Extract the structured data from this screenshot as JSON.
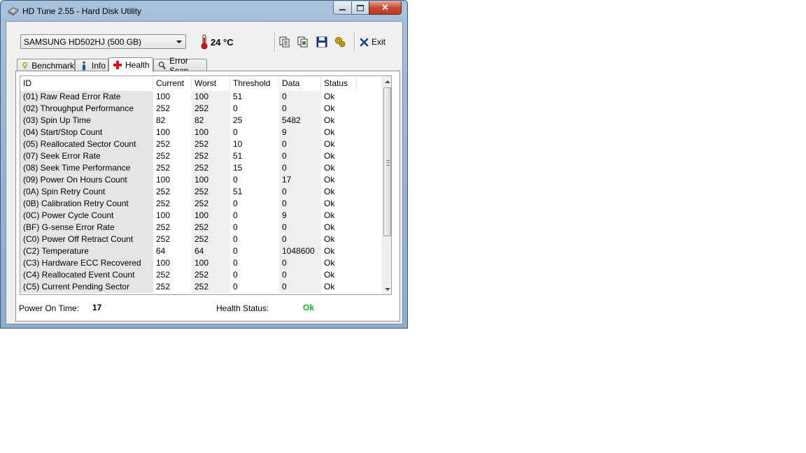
{
  "window": {
    "title": "HD Tune 2.55 - Hard Disk Utility",
    "close_symbol": "✕"
  },
  "toolbar": {
    "drive": "SAMSUNG HD502HJ (500 GB)",
    "temperature": "24 °C",
    "exit_label": "Exit",
    "icons": [
      "copy-info-icon",
      "copy-screenshot-icon",
      "save-icon",
      "options-icon",
      "exit-icon"
    ]
  },
  "tabs": [
    {
      "label": "Benchmark",
      "icon": "benchmark-icon",
      "active": false
    },
    {
      "label": "Info",
      "icon": "info-icon",
      "active": false
    },
    {
      "label": "Health",
      "icon": "health-icon",
      "active": true
    },
    {
      "label": "Error Scan",
      "icon": "error-scan-icon",
      "active": false
    }
  ],
  "health_table": {
    "columns": [
      "ID",
      "Current",
      "Worst",
      "Threshold",
      "Data",
      "Status"
    ],
    "rows": [
      [
        "(01) Raw Read Error Rate",
        "100",
        "100",
        "51",
        "0",
        "Ok"
      ],
      [
        "(02) Throughput Performance",
        "252",
        "252",
        "0",
        "0",
        "Ok"
      ],
      [
        "(03) Spin Up Time",
        "82",
        "82",
        "25",
        "5482",
        "Ok"
      ],
      [
        "(04) Start/Stop Count",
        "100",
        "100",
        "0",
        "9",
        "Ok"
      ],
      [
        "(05) Reallocated Sector Count",
        "252",
        "252",
        "10",
        "0",
        "Ok"
      ],
      [
        "(07) Seek Error Rate",
        "252",
        "252",
        "51",
        "0",
        "Ok"
      ],
      [
        "(08) Seek Time Performance",
        "252",
        "252",
        "15",
        "0",
        "Ok"
      ],
      [
        "(09) Power On Hours Count",
        "100",
        "100",
        "0",
        "17",
        "Ok"
      ],
      [
        "(0A) Spin Retry Count",
        "252",
        "252",
        "51",
        "0",
        "Ok"
      ],
      [
        "(0B) Calibration Retry Count",
        "252",
        "252",
        "0",
        "0",
        "Ok"
      ],
      [
        "(0C) Power Cycle Count",
        "100",
        "100",
        "0",
        "9",
        "Ok"
      ],
      [
        "(BF) G-sense Error Rate",
        "252",
        "252",
        "0",
        "0",
        "Ok"
      ],
      [
        "(C0) Power Off Retract Count",
        "252",
        "252",
        "0",
        "0",
        "Ok"
      ],
      [
        "(C2) Temperature",
        "64",
        "64",
        "0",
        "1048600",
        "Ok"
      ],
      [
        "(C3) Hardware ECC Recovered",
        "100",
        "100",
        "0",
        "0",
        "Ok"
      ],
      [
        "(C4) Reallocated Event Count",
        "252",
        "252",
        "0",
        "0",
        "Ok"
      ],
      [
        "(C5) Current Pending Sector",
        "252",
        "252",
        "0",
        "0",
        "Ok"
      ]
    ]
  },
  "status_bar": {
    "power_on_label": "Power On Time:",
    "power_on_value": "17",
    "health_label": "Health Status:",
    "health_value": "Ok"
  },
  "colors": {
    "health_ok": "#17b31a",
    "close_button": "#c74a33"
  }
}
